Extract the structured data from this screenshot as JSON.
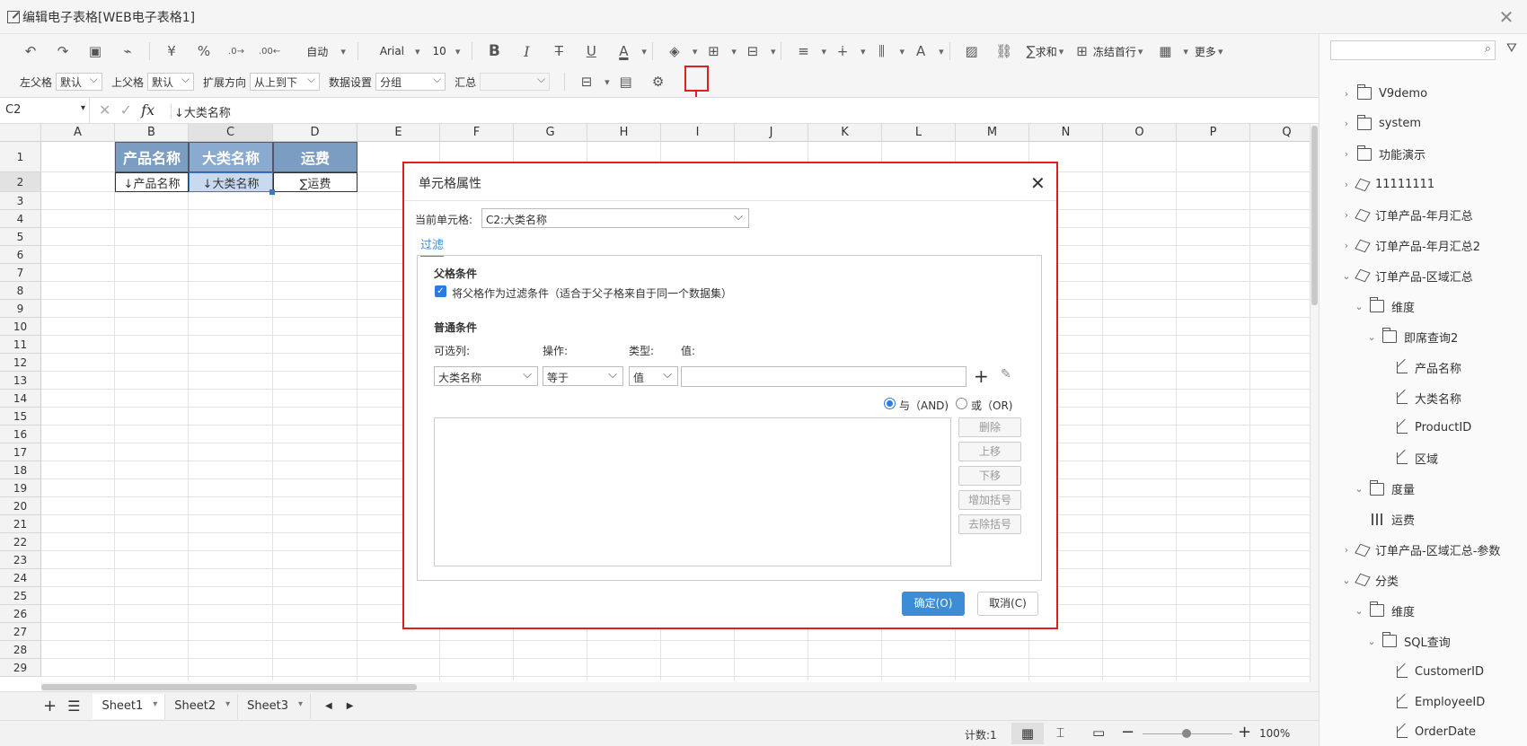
{
  "window": {
    "title": "编辑电子表格[WEB电子表格1]"
  },
  "toolbar": {
    "auto_label": "自动",
    "font_name": "Arial",
    "font_size": "10",
    "sum_label": "求和",
    "freeze_label": "冻结首行",
    "more_label": "更多",
    "currency": "¥",
    "percent": "%",
    "left_parent_label": "左父格",
    "left_parent_value": "默认",
    "top_parent_label": "上父格",
    "top_parent_value": "默认",
    "expand_label": "扩展方向",
    "expand_value": "从上到下",
    "data_setting_label": "数据设置",
    "data_setting_value": "分组",
    "summary_label": "汇总",
    "summary_value": ""
  },
  "formula_bar": {
    "cell_ref": "C2",
    "fx": "fx",
    "value": "↓大类名称"
  },
  "grid": {
    "columns": [
      "A",
      "B",
      "C",
      "D",
      "E",
      "F",
      "G",
      "H",
      "I",
      "J",
      "K",
      "L",
      "M",
      "N",
      "O",
      "P",
      "Q"
    ],
    "rows": [
      "1",
      "2",
      "3",
      "4",
      "5",
      "6",
      "7",
      "8",
      "9",
      "10",
      "11",
      "12",
      "13",
      "14",
      "15",
      "16",
      "17",
      "18",
      "19",
      "20",
      "21",
      "22",
      "23",
      "24",
      "25",
      "26",
      "27",
      "28",
      "29"
    ],
    "header_cells": [
      "产品名称",
      "大类名称",
      "运费"
    ],
    "data_cells": [
      "↓产品名称",
      "↓大类名称",
      "∑运费"
    ]
  },
  "sheets": [
    "Sheet1",
    "Sheet2",
    "Sheet3"
  ],
  "status": {
    "count": "计数:1",
    "zoom": "100%"
  },
  "tree": [
    {
      "label": "V9demo",
      "icon": "folder-icon",
      "level": 0,
      "arrow": "›"
    },
    {
      "label": "system",
      "icon": "folder-icon",
      "level": 0,
      "arrow": "›"
    },
    {
      "label": "功能演示",
      "icon": "folder-icon",
      "level": 0,
      "arrow": "›"
    },
    {
      "label": "11111111",
      "icon": "cube-icon",
      "level": 0,
      "arrow": "›"
    },
    {
      "label": "订单产品-年月汇总",
      "icon": "cube-icon",
      "level": 0,
      "arrow": "›"
    },
    {
      "label": "订单产品-年月汇总2",
      "icon": "cube-icon",
      "level": 0,
      "arrow": "›"
    },
    {
      "label": "订单产品-区域汇总",
      "icon": "cube-icon",
      "level": 0,
      "arrow": "⌄"
    },
    {
      "label": "维度",
      "icon": "folder-icon",
      "level": 1,
      "arrow": "⌄"
    },
    {
      "label": "即席查询2",
      "icon": "folder-icon",
      "level": 2,
      "arrow": "⌄"
    },
    {
      "label": "产品名称",
      "icon": "dimension-icon",
      "level": 3,
      "arrow": ""
    },
    {
      "label": "大类名称",
      "icon": "dimension-icon",
      "level": 3,
      "arrow": ""
    },
    {
      "label": "ProductID",
      "icon": "dimension-icon",
      "level": 3,
      "arrow": ""
    },
    {
      "label": "区域",
      "icon": "dimension-icon",
      "level": 3,
      "arrow": ""
    },
    {
      "label": "度量",
      "icon": "folder-icon",
      "level": 1,
      "arrow": "⌄"
    },
    {
      "label": "运费",
      "icon": "measure-icon",
      "level": 2,
      "arrow": ""
    },
    {
      "label": "订单产品-区域汇总-参数",
      "icon": "cube-icon",
      "level": 0,
      "arrow": "›"
    },
    {
      "label": "分类",
      "icon": "cube-icon",
      "level": 0,
      "arrow": "⌄"
    },
    {
      "label": "维度",
      "icon": "folder-icon",
      "level": 1,
      "arrow": "⌄"
    },
    {
      "label": "SQL查询",
      "icon": "folder-icon",
      "level": 2,
      "arrow": "⌄"
    },
    {
      "label": "CustomerID",
      "icon": "dimension-icon",
      "level": 3,
      "arrow": ""
    },
    {
      "label": "EmployeeID",
      "icon": "dimension-icon",
      "level": 3,
      "arrow": ""
    },
    {
      "label": "OrderDate",
      "icon": "dimension-icon",
      "level": 3,
      "arrow": ""
    }
  ],
  "dialog": {
    "title": "单元格属性",
    "current_cell_label": "当前单元格:",
    "current_cell_value": "C2:大类名称",
    "tab": "过滤",
    "parent_section": "父格条件",
    "parent_checkbox": "将父格作为过滤条件（适合于父子格来自于同一个数据集）",
    "normal_section": "普通条件",
    "col_label": "可选列:",
    "op_label": "操作:",
    "type_label": "类型:",
    "value_label": "值:",
    "col_value": "大类名称",
    "op_value": "等于",
    "type_value": "值",
    "and_label": "与（AND)",
    "or_label": "或（OR)",
    "btn_delete": "删除",
    "btn_up": "上移",
    "btn_down": "下移",
    "btn_add_paren": "增加括号",
    "btn_remove_paren": "去除括号",
    "ok": "确定(O)",
    "cancel": "取消(C)"
  },
  "colors": {
    "accent": "#3c8cd6",
    "header_fill": "#7b9dc1",
    "highlight": "#e02020"
  }
}
